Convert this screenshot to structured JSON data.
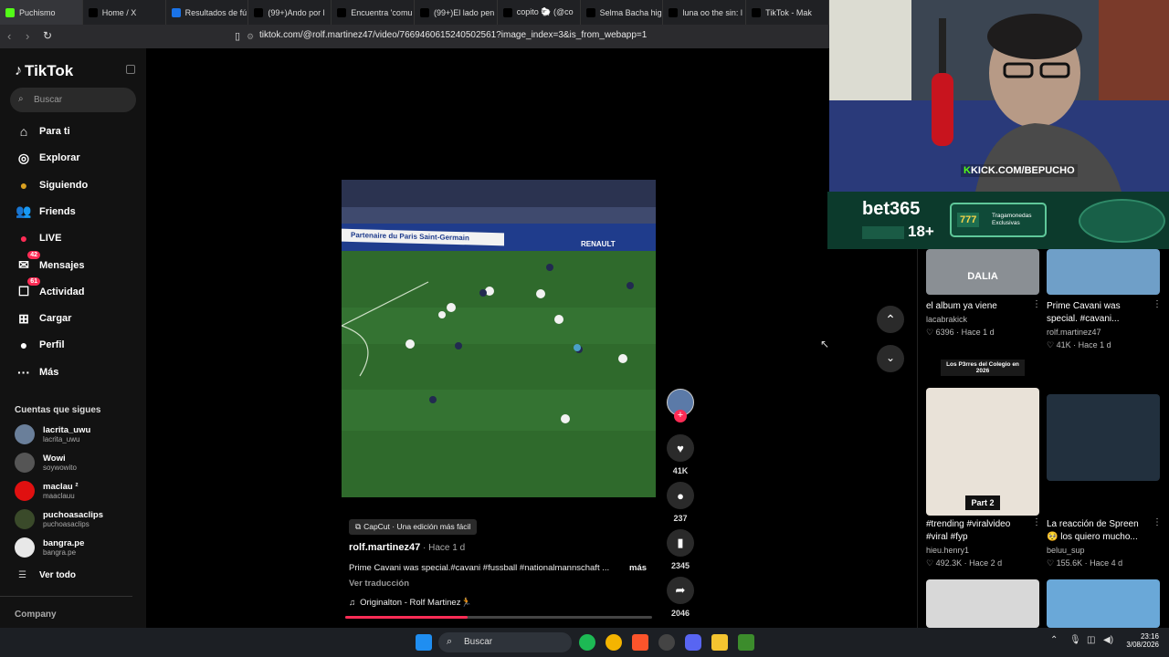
{
  "browser": {
    "tabs": [
      {
        "label": "Puchismo",
        "color": "#53fc18"
      },
      {
        "label": "Home / X",
        "color": "#000000"
      },
      {
        "label": "Resultados de fú",
        "color": "#1a73e8"
      },
      {
        "label": "(99+)Ando por l",
        "color": "#000000"
      },
      {
        "label": "Encuentra 'comu",
        "color": "#000000"
      },
      {
        "label": "(99+)El lado pen",
        "color": "#000000"
      },
      {
        "label": "copito 🐑 (@co",
        "color": "#000000"
      },
      {
        "label": "Selma Bacha hig",
        "color": "#000000"
      },
      {
        "label": "luna oo the sin: l",
        "color": "#000000"
      },
      {
        "label": "TikTok - Mak",
        "color": "#000000"
      }
    ],
    "url": "tiktok.com/@rolf.martinez47/video/7669460615240502561?image_index=3&is_from_webapp=1"
  },
  "sidebar": {
    "logo": "TikTok",
    "search_placeholder": "Buscar",
    "nav": [
      {
        "label": "Para ti",
        "icon": "home-icon",
        "glyph": "⌂"
      },
      {
        "label": "Explorar",
        "icon": "compass-icon",
        "glyph": "◎"
      },
      {
        "label": "Siguiendo",
        "icon": "following-avatar-icon",
        "glyph": "●"
      },
      {
        "label": "Friends",
        "icon": "friends-icon",
        "glyph": "👥"
      },
      {
        "label": "LIVE",
        "icon": "live-icon",
        "glyph": "●"
      },
      {
        "label": "Mensajes",
        "icon": "messages-icon",
        "glyph": "✉",
        "badge": "42"
      },
      {
        "label": "Actividad",
        "icon": "activity-icon",
        "glyph": "☐",
        "badge": "61"
      },
      {
        "label": "Cargar",
        "icon": "upload-icon",
        "glyph": "⊞"
      },
      {
        "label": "Perfil",
        "icon": "profile-icon",
        "glyph": "●"
      },
      {
        "label": "Más",
        "icon": "more-icon",
        "glyph": "···"
      }
    ],
    "following_title": "Cuentas que sigues",
    "accounts": [
      {
        "name": "lacrita_uwu",
        "handle": "lacrita_uwu",
        "color": "#6a7f9a"
      },
      {
        "name": "Wowi",
        "handle": "soywowito",
        "color": "#555555"
      },
      {
        "name": "maclau ²",
        "handle": "maaclauu",
        "color": "#e01010"
      },
      {
        "name": "puchoasaclips",
        "handle": "puchoasaclips",
        "color": "#3a4a2a"
      },
      {
        "name": "bangra.pe",
        "handle": "bangra.pe",
        "color": "#e8e8e8"
      }
    ],
    "see_all": "Ver todo",
    "company": "Company"
  },
  "video": {
    "capcut": "CapCut · Una edición más fácil",
    "author": "rolf.martinez47",
    "time": " · Hace 1 d",
    "caption": "Prime Cavani was special.#cavani #fussball #nationalmannschaft ...",
    "more": "más",
    "translate": "Ver traducción",
    "sound": "Originalton - Rolf Martinez🏃",
    "banner_text": "Partenaire du Paris Saint-Germain",
    "banner_brand": "RENAULT",
    "progress_percent": 40,
    "likes": "41K",
    "comments": "237",
    "saves": "2345",
    "shares": "2046"
  },
  "overlay": {
    "kick": "KICK.COM/BEPUCHO",
    "bet_brand": "bet365",
    "bet_age": "18+",
    "bet_slot": "Tragamonedas Exclusivas",
    "bet_slot_num": "777"
  },
  "feed": {
    "cards": [
      {
        "title": "el album ya viene",
        "user": "lacabrakick",
        "likes": "6396",
        "time": "Hace 1 d",
        "thumb_text": "DALIA",
        "thumb_color": "#8a8f94"
      },
      {
        "title": "Prime Cavani was special. #cavani...",
        "user": "rolf.martinez47",
        "likes": "41K",
        "time": "Hace 1 d",
        "thumb_text": "",
        "thumb_color": "#6f9fc8"
      },
      {
        "title": "#trending #viralvideo #viral #fyp",
        "user": "hieu.henry1",
        "likes": "492.3K",
        "time": "Hace 2 d",
        "thumb_text": "Part 2",
        "thumb_top": "Los P3rres del Colegio en 2026",
        "thumb_color": "#e9e2d8"
      },
      {
        "title": "La reacción de Spreen 🥺 los quiero mucho...",
        "user": "beluu_sup",
        "likes": "155.6K",
        "time": "Hace 4 d",
        "thumb_text": "",
        "thumb_color": "#22303e"
      }
    ]
  },
  "taskbar": {
    "search": "Buscar",
    "time": "23:16",
    "date": "3/08/2026"
  }
}
